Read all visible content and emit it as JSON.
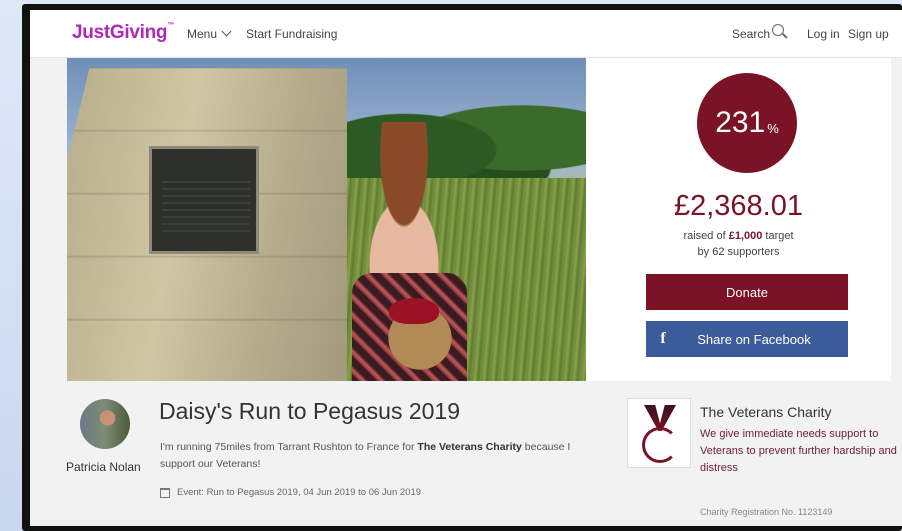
{
  "header": {
    "logo": "JustGiving",
    "logo_tm": "™",
    "menu_label": "Menu",
    "start_fundraising_label": "Start Fundraising",
    "search_label": "Search",
    "login_label": "Log in",
    "signup_label": "Sign up"
  },
  "progress": {
    "percent_value": "231",
    "percent_sign": "%",
    "raised_amount": "£2,368.01",
    "raised_prefix": "raised of ",
    "target_amount": "£1,000",
    "target_suffix": " target",
    "supporters_prefix": "by ",
    "supporters_count": "62",
    "supporters_suffix": " supporters",
    "donate_label": "Donate",
    "facebook_icon": "f",
    "facebook_label": "Share on Facebook"
  },
  "page": {
    "owner_name": "Patricia Nolan",
    "title": "Daisy's Run to Pegasus 2019",
    "story_before": "I'm running 75miles from Tarrant Rushton to France for ",
    "story_charity": "The Veterans Charity",
    "story_after": " because I support our Veterans!",
    "event_line": "Event: Run to Pegasus 2019, 04 Jun 2019 to 06 Jun 2019"
  },
  "charity": {
    "name": "The Veterans Charity",
    "description": "We give immediate needs support to Veterans to prevent further hardship and distress",
    "registration": "Charity Registration No. 1123149"
  },
  "colors": {
    "brand_purple": "#ad29b6",
    "accent_maroon": "#7b1327",
    "facebook_blue": "#3b5b9a"
  },
  "icons": {
    "menu": "chevron-down-icon",
    "search": "search-icon",
    "share": "facebook-icon",
    "event": "calendar-icon"
  }
}
